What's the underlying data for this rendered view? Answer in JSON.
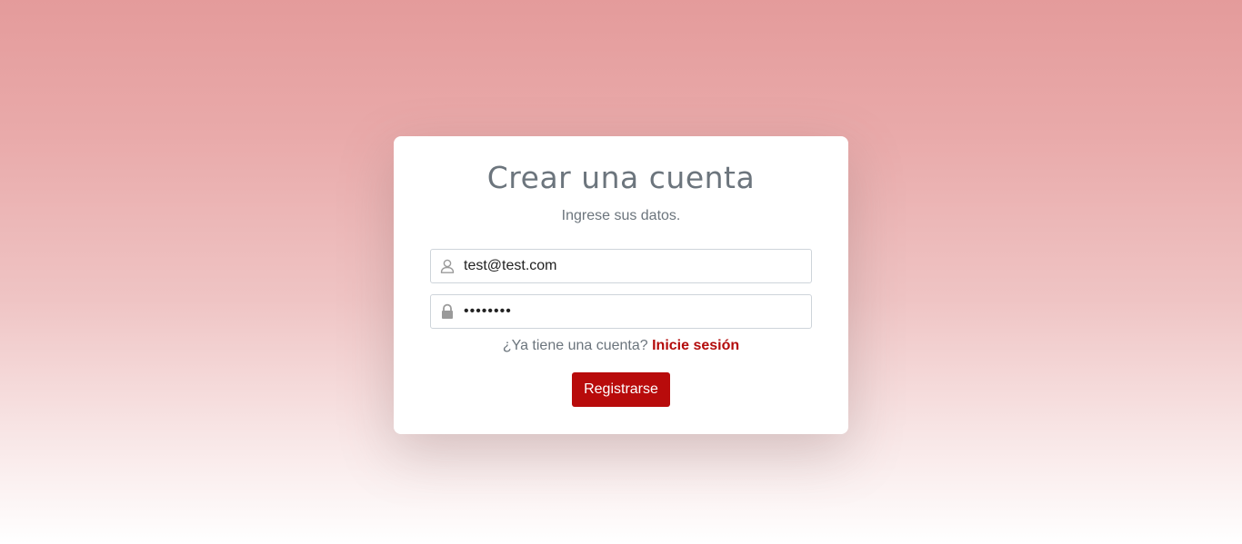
{
  "form": {
    "title": "Crear una cuenta",
    "subtitle": "Ingrese sus datos.",
    "email": {
      "value": "test@test.com",
      "icon": "user-icon"
    },
    "password": {
      "value": "••••••••",
      "icon": "lock-icon"
    },
    "login_prompt": "¿Ya tiene una cuenta?",
    "login_link": "Inicie sesión",
    "submit_label": "Registrarse"
  },
  "colors": {
    "accent": "#b80b0b",
    "link": "#b30b0b",
    "muted_text": "#6c757d",
    "background_top": "#e49b9b",
    "background_bottom": "#ffffff"
  }
}
